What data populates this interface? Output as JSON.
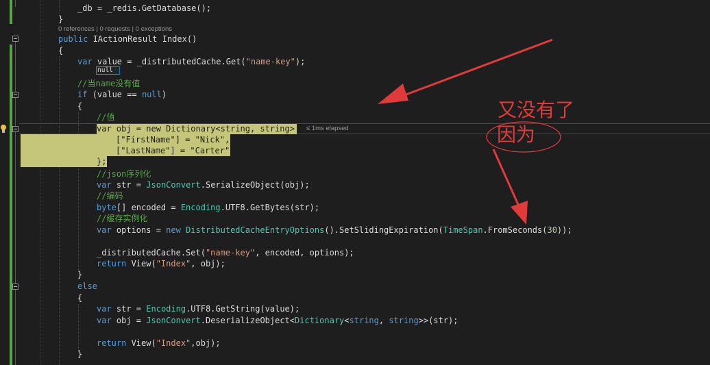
{
  "editor": {
    "lines": [
      {
        "id": "db-assign",
        "tokens": [
          {
            "t": "_db = _redis.",
            "c": ""
          },
          {
            "t": "GetDatabase",
            "c": ""
          },
          {
            "t": "();",
            "c": ""
          }
        ]
      },
      {
        "id": "brace-close-1",
        "tokens": [
          {
            "t": "}",
            "c": ""
          }
        ]
      },
      {
        "id": "method-decl",
        "tokens": [
          {
            "t": "public ",
            "c": "kw"
          },
          {
            "t": "IActionResult",
            "c": ""
          },
          {
            "t": " Index()",
            "c": ""
          }
        ]
      },
      {
        "id": "brace-open-method",
        "tokens": [
          {
            "t": "{",
            "c": ""
          }
        ]
      },
      {
        "id": "var-value",
        "tokens": [
          {
            "t": "var ",
            "c": "kw"
          },
          {
            "t": "value = _distributedCache.Get(",
            "c": ""
          },
          {
            "t": "\"name-key\"",
            "c": "str"
          },
          {
            "t": ");",
            "c": ""
          }
        ]
      },
      {
        "id": "comment-1",
        "tokens": [
          {
            "t": "//当name没有值",
            "c": "cm"
          }
        ]
      },
      {
        "id": "if-stmt",
        "tokens": [
          {
            "t": "if ",
            "c": "kw"
          },
          {
            "t": "(value == ",
            "c": ""
          },
          {
            "t": "null",
            "c": "kw"
          },
          {
            "t": ")",
            "c": ""
          }
        ]
      },
      {
        "id": "brace-open-if",
        "tokens": [
          {
            "t": "{",
            "c": ""
          }
        ]
      },
      {
        "id": "comment-2",
        "tokens": [
          {
            "t": "//值",
            "c": "cm"
          }
        ]
      },
      {
        "id": "var-obj",
        "tokens": [
          {
            "t": "var obj = new Dictionary<string, string> {",
            "c": "hl"
          }
        ]
      },
      {
        "id": "first-name",
        "tokens": [
          {
            "t": "[\"FirstName\"] = \"Nick\",",
            "c": "hl"
          }
        ]
      },
      {
        "id": "last-name",
        "tokens": [
          {
            "t": "[\"LastName\"] = \"Carter\"",
            "c": "hl"
          }
        ]
      },
      {
        "id": "dict-close",
        "tokens": [
          {
            "t": "};",
            "c": "hl"
          }
        ]
      },
      {
        "id": "comment-3",
        "tokens": [
          {
            "t": "//json序列化",
            "c": "cm"
          }
        ]
      },
      {
        "id": "var-str",
        "tokens": [
          {
            "t": "var ",
            "c": "kw"
          },
          {
            "t": "str = ",
            "c": ""
          },
          {
            "t": "JsonConvert",
            "c": "ty"
          },
          {
            "t": ".SerializeObject(obj);",
            "c": ""
          }
        ]
      },
      {
        "id": "comment-4",
        "tokens": [
          {
            "t": "//编码",
            "c": "cm"
          }
        ]
      },
      {
        "id": "byte-encoded",
        "tokens": [
          {
            "t": "byte",
            "c": "kw"
          },
          {
            "t": "[] encoded = ",
            "c": ""
          },
          {
            "t": "Encoding",
            "c": "ty"
          },
          {
            "t": ".UTF8.GetBytes(str);",
            "c": ""
          }
        ]
      },
      {
        "id": "comment-5",
        "tokens": [
          {
            "t": "//缓存实例化",
            "c": "cm"
          }
        ]
      },
      {
        "id": "var-options",
        "tokens": [
          {
            "t": "var ",
            "c": "kw"
          },
          {
            "t": "options = ",
            "c": ""
          },
          {
            "t": "new ",
            "c": "kw"
          },
          {
            "t": "DistributedCacheEntryOptions",
            "c": "ty"
          },
          {
            "t": "().SetSlidingExpiration(",
            "c": ""
          },
          {
            "t": "TimeSpan",
            "c": "ty"
          },
          {
            "t": ".FromSeconds(",
            "c": ""
          },
          {
            "t": "30",
            "c": "num"
          },
          {
            "t": "));",
            "c": ""
          }
        ]
      },
      {
        "id": "blank-1",
        "tokens": []
      },
      {
        "id": "cache-set",
        "tokens": [
          {
            "t": "_distributedCache.Set(",
            "c": ""
          },
          {
            "t": "\"name-key\"",
            "c": "str"
          },
          {
            "t": ", encoded, options);",
            "c": ""
          }
        ]
      },
      {
        "id": "return-1",
        "tokens": [
          {
            "t": "return ",
            "c": "kw"
          },
          {
            "t": "View(",
            "c": ""
          },
          {
            "t": "\"Index\"",
            "c": "str"
          },
          {
            "t": ", obj);",
            "c": ""
          }
        ]
      },
      {
        "id": "brace-close-if",
        "tokens": [
          {
            "t": "}",
            "c": ""
          }
        ]
      },
      {
        "id": "else-stmt",
        "tokens": [
          {
            "t": "else",
            "c": "kw"
          }
        ]
      },
      {
        "id": "brace-open-else",
        "tokens": [
          {
            "t": "{",
            "c": ""
          }
        ]
      },
      {
        "id": "blank-2",
        "tokens": []
      },
      {
        "id": "var-str-2",
        "tokens": [
          {
            "t": "var ",
            "c": "kw"
          },
          {
            "t": "str = ",
            "c": ""
          },
          {
            "t": "Encoding",
            "c": "ty"
          },
          {
            "t": ".UTF8.GetString(value);",
            "c": ""
          }
        ]
      },
      {
        "id": "var-obj-2",
        "tokens": [
          {
            "t": "var ",
            "c": "kw"
          },
          {
            "t": "obj = ",
            "c": ""
          },
          {
            "t": "JsonConvert",
            "c": "ty"
          },
          {
            "t": ".DeserializeObject<",
            "c": ""
          },
          {
            "t": "Dictionary",
            "c": "ty"
          },
          {
            "t": "<",
            "c": ""
          },
          {
            "t": "string",
            "c": "kw"
          },
          {
            "t": ", ",
            "c": ""
          },
          {
            "t": "string",
            "c": "kw"
          },
          {
            "t": ">>(str);",
            "c": ""
          }
        ]
      },
      {
        "id": "blank-3",
        "tokens": []
      },
      {
        "id": "return-2",
        "tokens": [
          {
            "t": "return ",
            "c": "kw"
          },
          {
            "t": "View(",
            "c": ""
          },
          {
            "t": "\"Index\"",
            "c": "str"
          },
          {
            "t": ",obj);",
            "c": ""
          }
        ]
      },
      {
        "id": "brace-close-else",
        "tokens": [
          {
            "t": "}",
            "c": ""
          }
        ]
      }
    ],
    "codelens": "0 references | 0 requests | 0 exceptions",
    "datatip_value": "null",
    "elapsed_label": "≤ 1ms elapsed"
  },
  "annotation": {
    "line1": "又没有了",
    "line2": "因为",
    "color": "#e03b3b"
  },
  "colors": {
    "background": "#1e1e1e",
    "keyword": "#569cd6",
    "type": "#4ec9b0",
    "string": "#d69d85",
    "comment": "#57a64a",
    "highlight": "#c5c67a"
  }
}
